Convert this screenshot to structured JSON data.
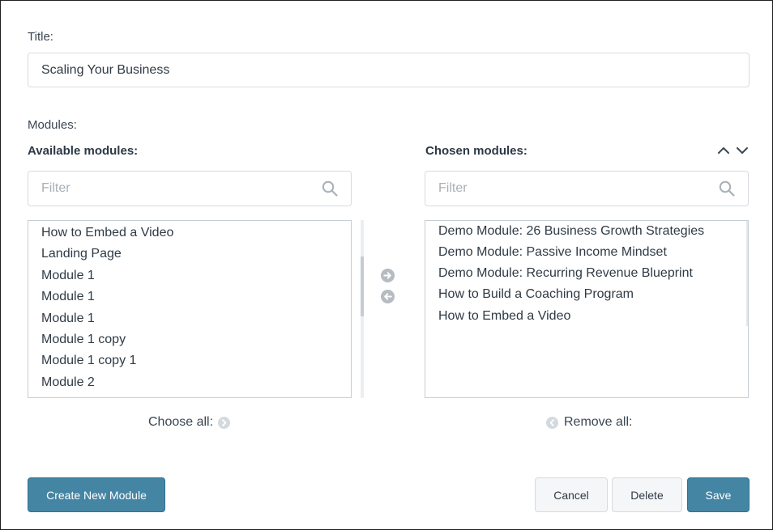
{
  "form": {
    "title_label": "Title:",
    "title_value": "Scaling Your Business",
    "modules_label": "Modules:"
  },
  "available": {
    "heading": "Available modules:",
    "filter_placeholder": "Filter",
    "items": [
      "How to Embed a Video",
      "Landing Page",
      "Module 1",
      "Module 1",
      "Module 1",
      "Module 1 copy",
      "Module 1 copy 1",
      "Module 2"
    ],
    "choose_all_label": "Choose all:"
  },
  "chosen": {
    "heading": "Chosen modules:",
    "filter_placeholder": "Filter",
    "items": [
      "Demo Module: 26 Business Growth Strategies",
      "Demo Module: Passive Income Mindset",
      "Demo Module: Recurring Revenue Blueprint",
      "How to Build a Coaching Program",
      "How to Embed a Video"
    ],
    "remove_all_label": "Remove all:"
  },
  "buttons": {
    "create": "Create New Module",
    "cancel": "Cancel",
    "delete": "Delete",
    "save": "Save"
  },
  "icons": {
    "move_right": "arrow-right-circle-icon",
    "move_left": "arrow-left-circle-icon",
    "search": "search-icon",
    "move_up": "chevron-up-icon",
    "move_down": "chevron-down-icon"
  },
  "colors": {
    "primary": "#4485a3",
    "muted_icon": "#b5bcc2"
  }
}
